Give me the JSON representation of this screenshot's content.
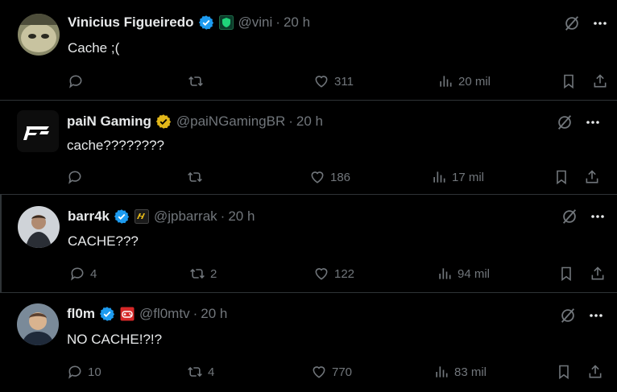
{
  "posts": [
    {
      "display_name": "Vinicius Figueiredo",
      "handle": "@vini",
      "separator": "·",
      "time": "20 h",
      "text": "Cache ;(",
      "verified_color": "#1d9bf0",
      "badge_icon": "shield-badge-icon",
      "replies": "",
      "reposts": "",
      "likes": "311",
      "views": "20 mil"
    },
    {
      "display_name": "paiN Gaming",
      "handle": "@paiNGamingBR",
      "separator": "·",
      "time": "20 h",
      "text": "cache????????",
      "verified_color": "#e2b719",
      "badge_icon": "",
      "replies": "",
      "reposts": "",
      "likes": "186",
      "views": "17 mil"
    },
    {
      "display_name": "barr4k",
      "handle": "@jpbarrak",
      "separator": "·",
      "time": "20 h",
      "text": "CACHE???",
      "verified_color": "#1d9bf0",
      "badge_icon": "org-badge-icon",
      "replies": "4",
      "reposts": "2",
      "likes": "122",
      "views": "94 mil"
    },
    {
      "display_name": "fl0m",
      "handle": "@fl0mtv",
      "separator": "·",
      "time": "20 h",
      "text": "NO CACHE!?!?",
      "verified_color": "#1d9bf0",
      "badge_icon": "gamepad-badge-icon",
      "replies": "10",
      "reposts": "4",
      "likes": "770",
      "views": "83 mil"
    }
  ],
  "colors": {
    "background": "#000000",
    "text": "#e7e9ea",
    "muted": "#71767b",
    "divider": "#2f3336",
    "blue_verified": "#1d9bf0",
    "gold_verified": "#e2b719"
  }
}
